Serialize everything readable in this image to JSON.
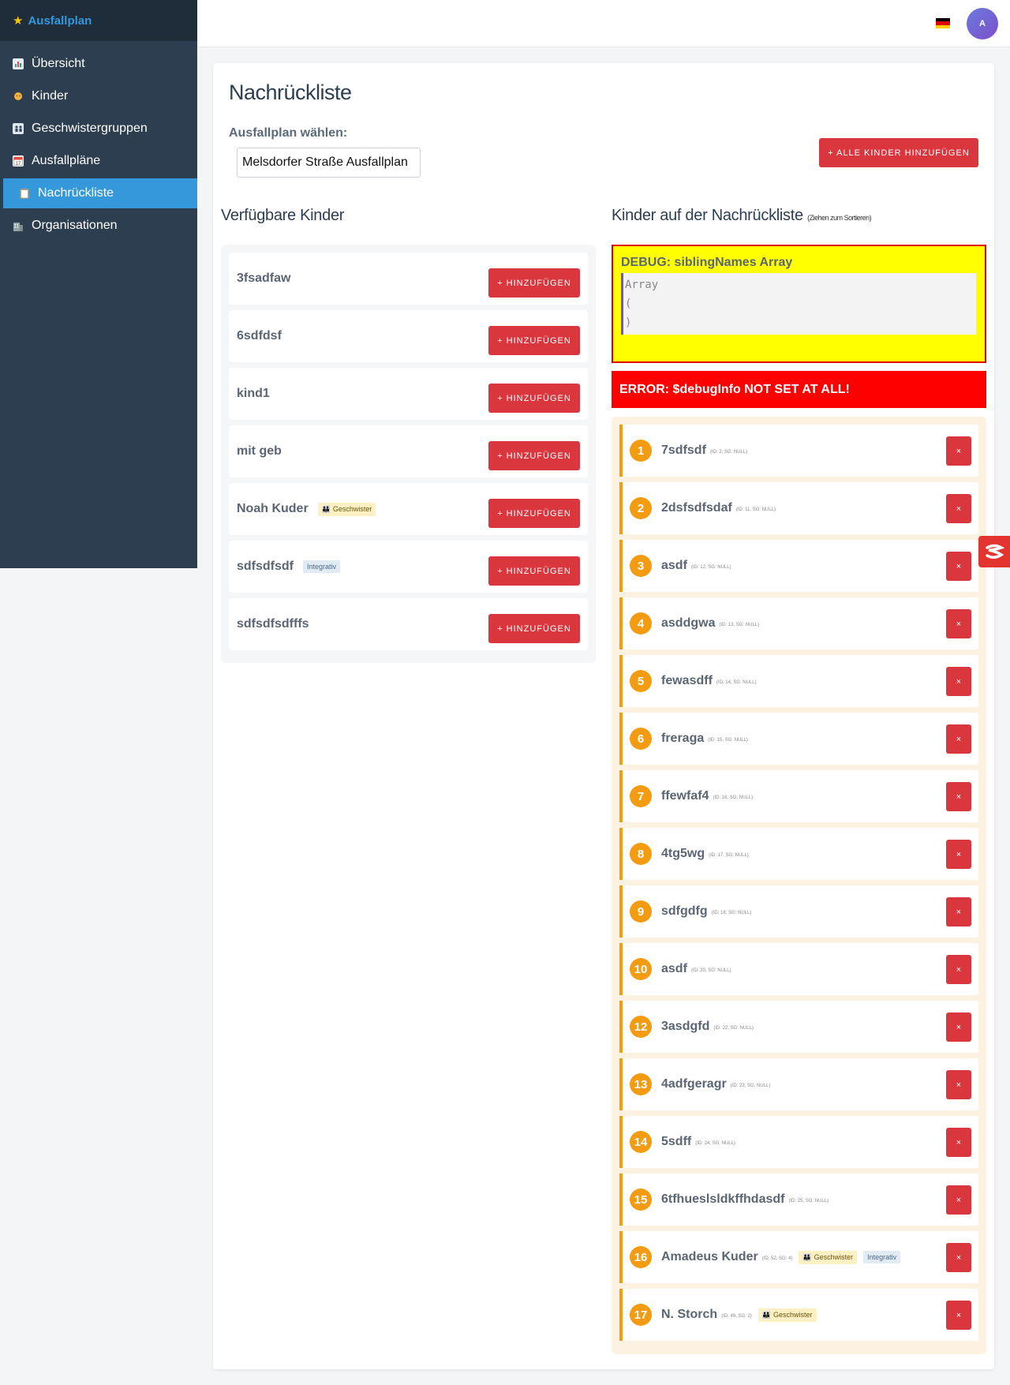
{
  "brand": {
    "icon": "star-icon",
    "title": "Ausfallplan"
  },
  "sidebar": {
    "items": [
      {
        "icon": "chart-icon",
        "label": "Übersicht",
        "active": false
      },
      {
        "icon": "baby-icon",
        "label": "Kinder",
        "active": false
      },
      {
        "icon": "family-icon",
        "label": "Geschwistergruppen",
        "active": false
      },
      {
        "icon": "calendar-icon",
        "label": "Ausfallpläne",
        "active": false
      },
      {
        "icon": "clipboard-icon",
        "label": "Nachrückliste",
        "active": true
      },
      {
        "icon": "building-icon",
        "label": "Organisationen",
        "active": false
      }
    ]
  },
  "topbar": {
    "language": "de-flag-icon",
    "avatar_initial": "A",
    "avatar_color": "#6c5ce7"
  },
  "page": {
    "title": "Nachrückliste",
    "plan_label": "Ausfallplan wählen:",
    "plan_selected": "Melsdorfer Straße Ausfallplan",
    "add_all_label": "+ ALLE KINDER HINZUFÜGEN"
  },
  "available": {
    "title": "Verfügbare Kinder",
    "add_label": "+ HINZUFÜGEN",
    "items": [
      {
        "name": "3fsadfaw"
      },
      {
        "name": "6sdfdsf"
      },
      {
        "name": "kind1"
      },
      {
        "name": "mit geb"
      },
      {
        "name": "Noah Kuder",
        "badge_sibling": "Geschwister"
      },
      {
        "name": "sdfsdfsdf",
        "badge_integrative": "Integrativ"
      },
      {
        "name": "sdfsdfsdfffs"
      }
    ]
  },
  "queue": {
    "title": "Kinder auf der Nachrückliste",
    "hint": "(Ziehen zum Sortieren)",
    "remove_label": "×",
    "items": [
      {
        "num": "1",
        "name": "7sdfsdf",
        "meta": "(ID: 2, SG: NULL)"
      },
      {
        "num": "2",
        "name": "2dsfsdfsdaf",
        "meta": "(ID: 11, SG: NULL)"
      },
      {
        "num": "3",
        "name": "asdf",
        "meta": "(ID: 12, SG: NULL)"
      },
      {
        "num": "4",
        "name": "asddgwa",
        "meta": "(ID: 13, SG: NULL)"
      },
      {
        "num": "5",
        "name": "fewasdff",
        "meta": "(ID: 14, SG: NULL)"
      },
      {
        "num": "6",
        "name": "freraga",
        "meta": "(ID: 15, SG: NULL)"
      },
      {
        "num": "7",
        "name": "ffewfaf4",
        "meta": "(ID: 16, SG: NULL)"
      },
      {
        "num": "8",
        "name": "4tg5wg",
        "meta": "(ID: 17, SG: NULL)"
      },
      {
        "num": "9",
        "name": "sdfgdfg",
        "meta": "(ID: 18, SG: NULL)"
      },
      {
        "num": "10",
        "name": "asdf",
        "meta": "(ID: 20, SG: NULL)"
      },
      {
        "num": "12",
        "name": "3asdgfd",
        "meta": "(ID: 22, SG: NULL)"
      },
      {
        "num": "13",
        "name": "4adfgeragr",
        "meta": "(ID: 23, SG: NULL)"
      },
      {
        "num": "14",
        "name": "5sdff",
        "meta": "(ID: 24, SG: NULL)"
      },
      {
        "num": "15",
        "name": "6tfhueslsldkffhdasdf",
        "meta": "(ID: 25, SG: NULL)"
      },
      {
        "num": "16",
        "name": "Amadeus Kuder",
        "meta": "(ID: 52, SG: 4)",
        "badge_sibling": "Geschwister",
        "badge_integrative": "Integrativ"
      },
      {
        "num": "17",
        "name": "N. Storch",
        "meta": "(ID: 49, SG: 2)",
        "badge_sibling": "Geschwister"
      }
    ]
  },
  "debug": {
    "title": "DEBUG: siblingNames Array",
    "pre": "Array\n(\n)",
    "error": "ERROR: $debugInfo NOT SET AT ALL!"
  },
  "colors": {
    "sidebar": "#2c3e50",
    "accent": "#3498db",
    "danger": "#d9363e",
    "queue": "#f39c12"
  }
}
